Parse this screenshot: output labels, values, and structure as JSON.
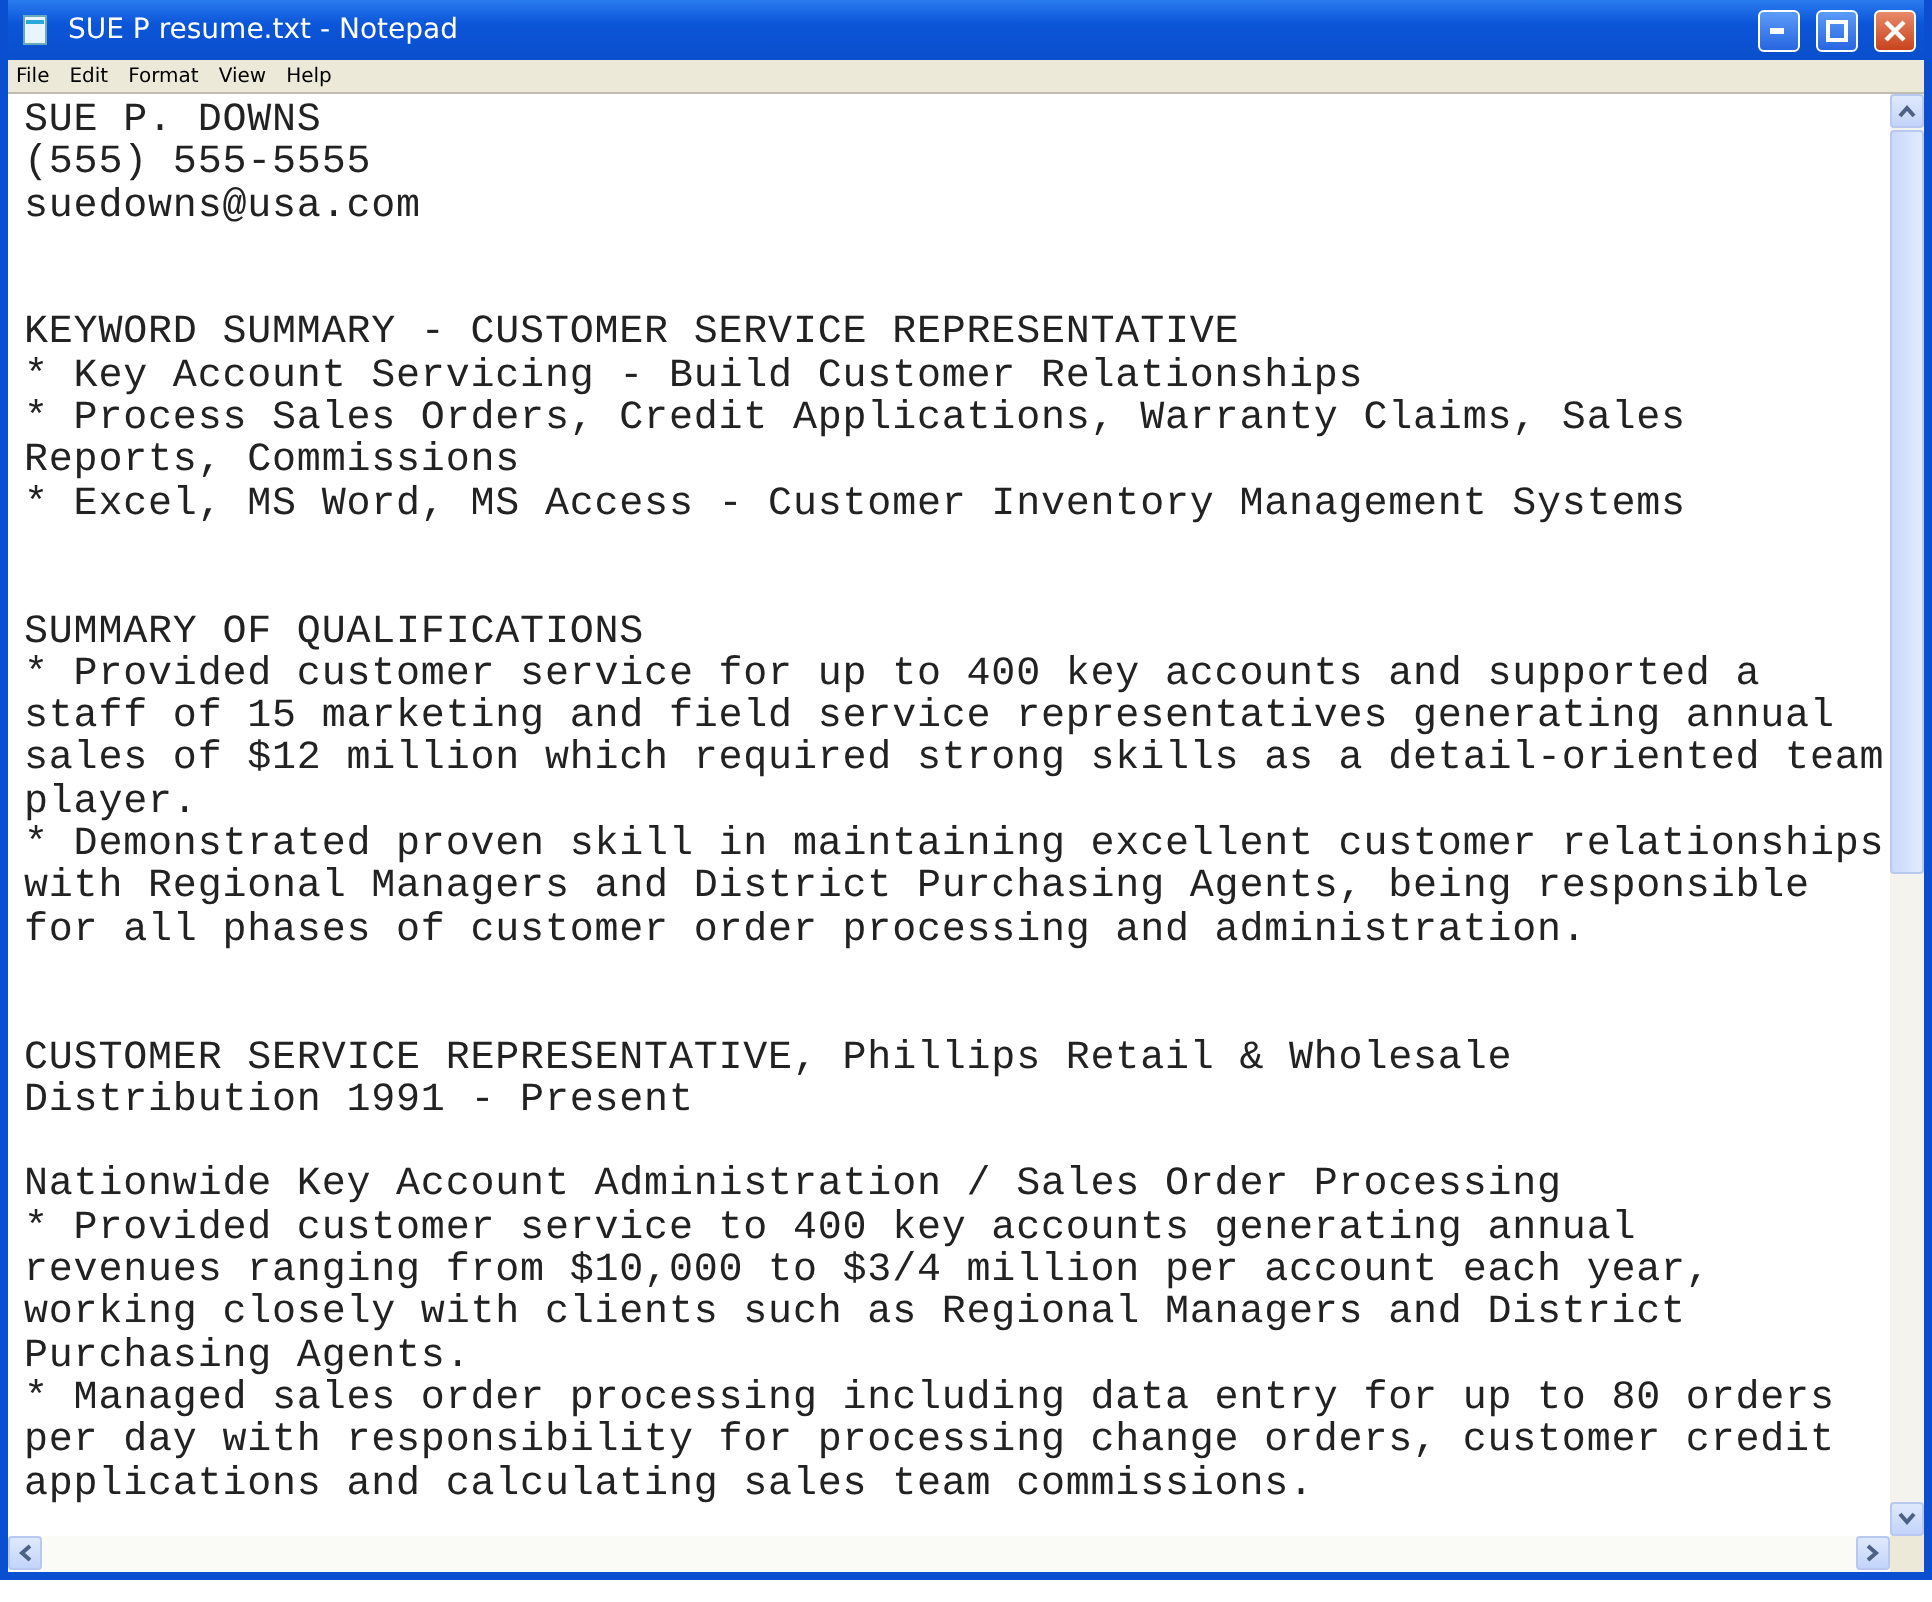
{
  "window": {
    "title": "SUE P resume.txt - Notepad"
  },
  "menu": [
    "File",
    "Edit",
    "Format",
    "View",
    "Help"
  ],
  "document": [
    {
      "kind": "header",
      "items": [
        {
          "lines": [
            "SUE P. DOWNS"
          ]
        },
        {
          "lines": [
            "(555) 555-5555"
          ]
        },
        {
          "lines": [
            "suedowns@usa.com"
          ]
        }
      ]
    },
    {
      "kind": "section",
      "items": [
        {
          "lines": [
            "KEYWORD SUMMARY - CUSTOMER SERVICE REPRESENTATIVE"
          ]
        },
        {
          "lines": [
            "* Key Account Servicing - Build Customer Relationships"
          ]
        },
        {
          "lines": [
            "* Process Sales Orders, Credit Applications, Warranty Claims, Sales",
            "Reports, Commissions"
          ]
        },
        {
          "lines": [
            "* Excel, MS Word, MS Access - Customer Inventory Management Systems"
          ]
        }
      ]
    },
    {
      "kind": "section",
      "items": [
        {
          "lines": [
            "SUMMARY OF QUALIFICATIONS"
          ]
        },
        {
          "lines": [
            "* Provided customer service for up to 400 key accounts and supported a",
            "staff of 15 marketing and field service representatives generating annual",
            "sales of $12 million which required strong skills as a detail-oriented team",
            "player."
          ]
        },
        {
          "lines": [
            "* Demonstrated proven skill in maintaining excellent customer relationships",
            "with Regional Managers and District Purchasing Agents, being responsible",
            "for all phases of customer order processing and administration."
          ]
        }
      ]
    },
    {
      "kind": "section",
      "items": [
        {
          "lines": [
            "CUSTOMER SERVICE REPRESENTATIVE, Phillips Retail & Wholesale",
            "Distribution 1991 - Present"
          ]
        }
      ]
    },
    {
      "kind": "paragraph",
      "items": [
        {
          "lines": [
            "Nationwide Key Account Administration / Sales Order Processing"
          ]
        },
        {
          "lines": [
            "* Provided customer service to 400 key accounts generating annual",
            "revenues ranging from $10,000 to $3/4 million per account each year,",
            "working closely with clients such as Regional Managers and District",
            "Purchasing Agents."
          ]
        },
        {
          "lines": [
            "* Managed sales order processing including data entry for up to 80 orders",
            "per day with responsibility for processing change orders, customer credit",
            "applications and calculating sales team commissions."
          ]
        }
      ]
    }
  ]
}
